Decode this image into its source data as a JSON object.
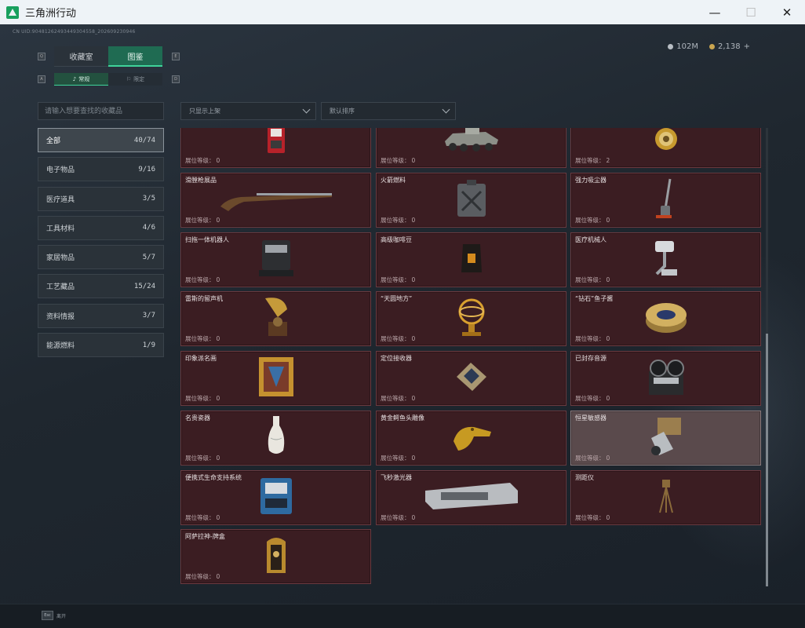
{
  "window": {
    "title": "三角洲行动",
    "minimize": "—",
    "maximize": "☐",
    "close": "✕"
  },
  "header": {
    "uid": "CN UID:9048126249344930455​8_202609230946",
    "currency": [
      {
        "icon": "silver-coin-icon",
        "value": "102M"
      },
      {
        "icon": "gold-coin-icon",
        "value": "2,138",
        "suffix": "+"
      }
    ],
    "key_hints": {
      "left": "Q",
      "right": "E",
      "sub_left": "A",
      "sub_right": "D"
    }
  },
  "tabs": [
    {
      "label": "收藏室",
      "active": false
    },
    {
      "label": "图鉴",
      "active": true
    }
  ],
  "sub_tabs": [
    {
      "label": "常规",
      "icon": "music-note-icon",
      "active": true
    },
    {
      "label": "限定",
      "icon": "banner-icon",
      "active": false
    }
  ],
  "search": {
    "placeholder": "请输入想要查找的收藏品",
    "value": ""
  },
  "categories": [
    {
      "label": "全部",
      "count": "40/74",
      "active": true
    },
    {
      "label": "电子物品",
      "count": "9/16"
    },
    {
      "label": "医疗道具",
      "count": "3/5"
    },
    {
      "label": "工具材料",
      "count": "4/6"
    },
    {
      "label": "家居物品",
      "count": "5/7"
    },
    {
      "label": "工艺藏品",
      "count": "15/24"
    },
    {
      "label": "资料情报",
      "count": "3/7"
    },
    {
      "label": "能源燃料",
      "count": "1/9"
    }
  ],
  "filters": {
    "shelf": "只显示上架",
    "sort": "默认排序"
  },
  "level_label": "展位等级：",
  "items": [
    {
      "name": "",
      "level": "0",
      "icon": "arcade-machine-icon"
    },
    {
      "name": "",
      "level": "0",
      "icon": "armored-vehicle-icon"
    },
    {
      "name": "",
      "level": "2",
      "icon": "gold-watch-icon"
    },
    {
      "name": "滑膛枪展品",
      "level": "0",
      "icon": "musket-icon"
    },
    {
      "name": "火箭燃料",
      "level": "0",
      "icon": "fuel-can-icon"
    },
    {
      "name": "强力吸尘器",
      "level": "0",
      "icon": "vacuum-cleaner-icon"
    },
    {
      "name": "扫拖一体机器人",
      "level": "0",
      "icon": "robot-mop-icon"
    },
    {
      "name": "高级咖啡豆",
      "level": "0",
      "icon": "coffee-bag-icon"
    },
    {
      "name": "医疗机械人",
      "level": "0",
      "icon": "medical-robot-icon"
    },
    {
      "name": "雷斯的留声机",
      "level": "0",
      "icon": "gramophone-icon"
    },
    {
      "name": "“天圆地方”",
      "level": "0",
      "icon": "armillary-sphere-icon"
    },
    {
      "name": "“钻石”鱼子酱",
      "level": "0",
      "icon": "caviar-tin-icon"
    },
    {
      "name": "印象派名画",
      "level": "0",
      "icon": "framed-painting-icon"
    },
    {
      "name": "定位接收器",
      "level": "0",
      "icon": "locator-receiver-icon"
    },
    {
      "name": "已封存音源",
      "level": "0",
      "icon": "reel-recorder-icon"
    },
    {
      "name": "名贵瓷器",
      "level": "0",
      "icon": "porcelain-vase-icon"
    },
    {
      "name": "黄金鳄鱼头雕像",
      "level": "0",
      "icon": "gold-crocodile-icon"
    },
    {
      "name": "恒星敏感器",
      "level": "0",
      "icon": "star-sensor-icon",
      "highlight": true
    },
    {
      "name": "便携式生命支持系统",
      "level": "0",
      "icon": "life-support-icon"
    },
    {
      "name": "飞秒激光器",
      "level": "0",
      "icon": "femtosecond-laser-icon"
    },
    {
      "name": "测距仪",
      "level": "0",
      "icon": "rangefinder-icon"
    },
    {
      "name": "阿萨拉神-牌盒",
      "level": "0",
      "icon": "card-box-icon"
    }
  ],
  "bottom": {
    "esc_key": "Esc",
    "esc_label": "离开"
  },
  "colors": {
    "accent": "#3fd39a",
    "card_bg": "#3b1d22",
    "card_border": "#6a3a40"
  }
}
